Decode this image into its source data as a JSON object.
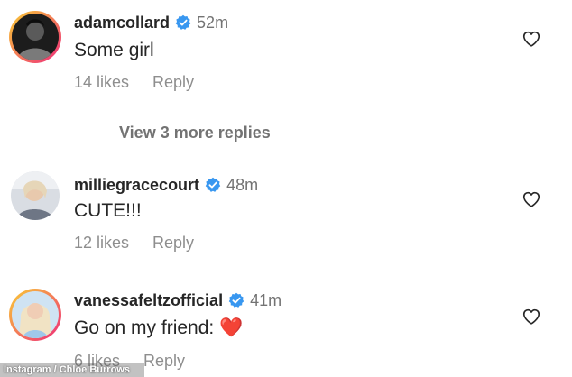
{
  "colors": {
    "verified_badge": "#3897f0",
    "story_ring_start": "#f9ce34",
    "story_ring_end": "#ee2a7b",
    "heart_red": "#e0262f"
  },
  "comments": [
    {
      "username": "adamcollard",
      "time": "52m",
      "text": "Some girl",
      "likes": "14 likes",
      "reply": "Reply",
      "avatar": "avatar-photo",
      "has_story_ring": true
    },
    {
      "username": "milliegracecourt",
      "time": "48m",
      "text": "CUTE!!!",
      "likes": "12 likes",
      "reply": "Reply",
      "avatar": "avatar-photo",
      "has_story_ring": false
    },
    {
      "username": "vanessafeltzofficial",
      "time": "41m",
      "text": "Go on my friend: ",
      "emoji": "❤️",
      "likes": "6 likes",
      "reply": "Reply",
      "avatar": "avatar-photo",
      "has_story_ring": true
    }
  ],
  "view_replies": {
    "label": "View 3 more replies"
  },
  "credit": {
    "text": "Instagram / Chloe Burrows"
  }
}
